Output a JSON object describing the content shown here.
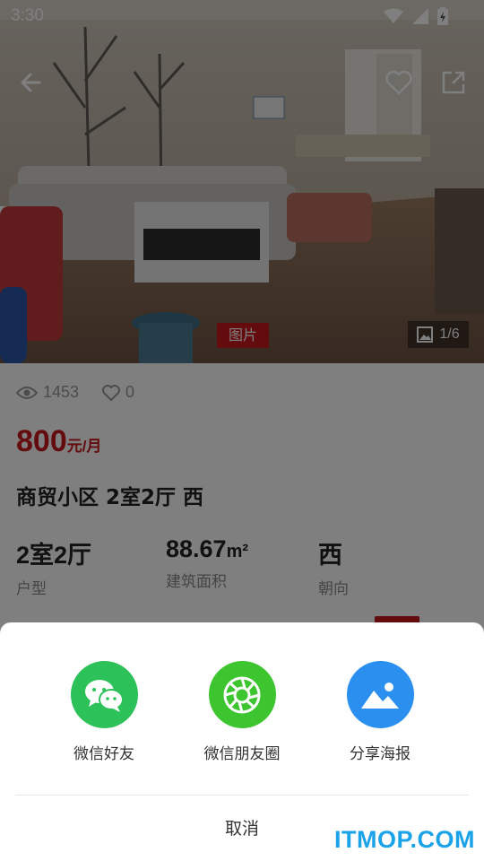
{
  "status_bar": {
    "time": "3:30"
  },
  "photo": {
    "tag": "图片",
    "counter": "1/6"
  },
  "stats": {
    "views": "1453",
    "likes": "0"
  },
  "price": {
    "value": "800",
    "unit": "元/月"
  },
  "title": "商贸小区 2室2厅 西",
  "specs": [
    {
      "value": "2室2厅",
      "label": "户型"
    },
    {
      "value": "88.67",
      "unit": "m²",
      "label": "建筑面积"
    },
    {
      "value": "西",
      "label": "朝向"
    }
  ],
  "share_sheet": {
    "items": [
      {
        "label": "微信好友",
        "color": "#2dc15a",
        "icon": "wechat-icon"
      },
      {
        "label": "微信朋友圈",
        "color": "#3cc52e",
        "icon": "moments-icon"
      },
      {
        "label": "分享海报",
        "color": "#2b8ff0",
        "icon": "poster-icon"
      }
    ],
    "cancel_label": "取消"
  },
  "watermark": "ITMOP.COM",
  "colors": {
    "accent": "#c8161d",
    "watermark": "#1aa3e8"
  }
}
